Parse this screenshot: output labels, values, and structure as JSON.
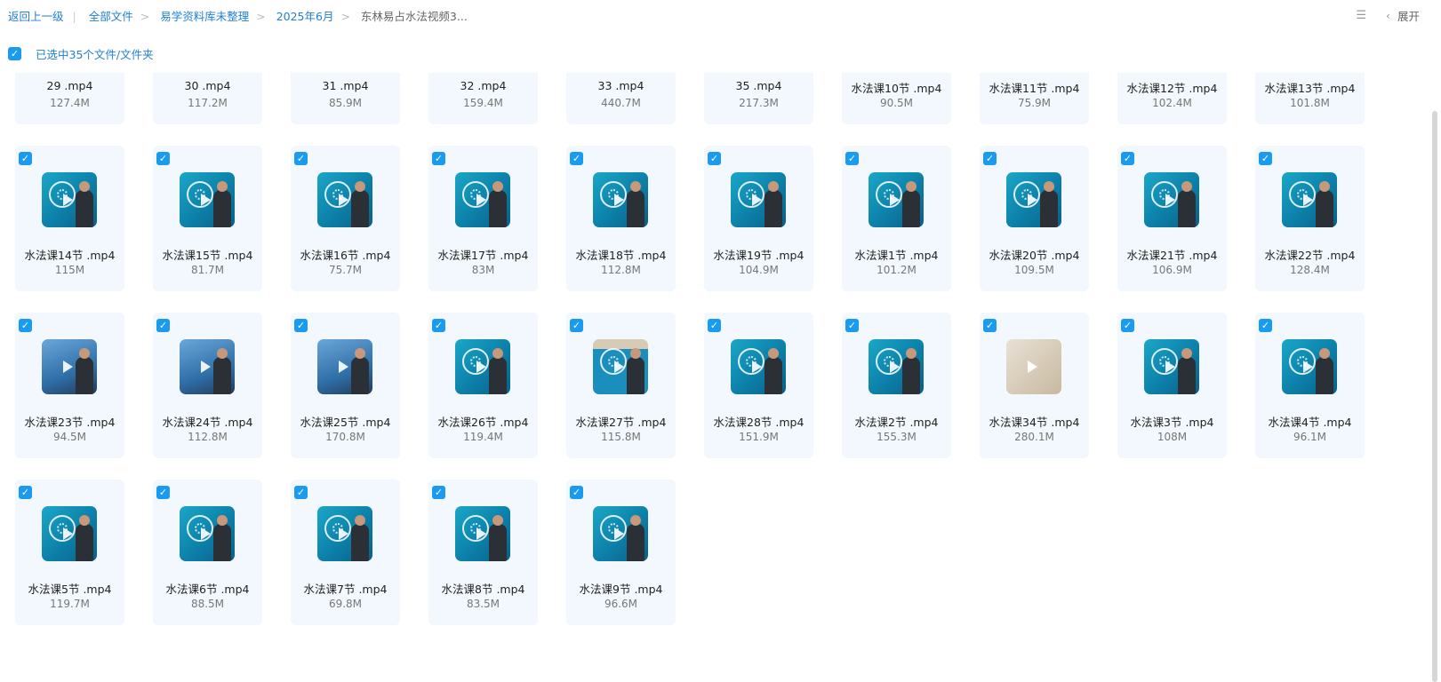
{
  "breadcrumb": {
    "back": "返回上一级",
    "items": [
      "全部文件",
      "易学资料库未整理",
      "2025年6月"
    ],
    "current": "东林易占水法视频3..."
  },
  "top_right": {
    "view_icon": "list-view-icon",
    "expand_label": "展开"
  },
  "selection": {
    "label": "已选中35个文件/文件夹",
    "checked": true
  },
  "colors": {
    "accent": "#1a9bf0",
    "link": "#1f7fd6",
    "card_bg": "#f2f8fd"
  },
  "files": [
    {
      "name": "29 .mp4",
      "size": "127.4M",
      "thumb": "mosaic"
    },
    {
      "name": "30 .mp4",
      "size": "117.2M",
      "thumb": "chart"
    },
    {
      "name": "31 .mp4",
      "size": "85.9M",
      "thumb": "chart"
    },
    {
      "name": "32 .mp4",
      "size": "159.4M",
      "thumb": "chart"
    },
    {
      "name": "33 .mp4",
      "size": "440.7M",
      "thumb": "mosaic"
    },
    {
      "name": "35 .mp4",
      "size": "217.3M",
      "thumb": "paper"
    },
    {
      "name": "水法课10节 .mp4",
      "size": "90.5M",
      "thumb": "lecture"
    },
    {
      "name": "水法课11节 .mp4",
      "size": "75.9M",
      "thumb": "lecture"
    },
    {
      "name": "水法课12节 .mp4",
      "size": "102.4M",
      "thumb": "lecture"
    },
    {
      "name": "水法课13节 .mp4",
      "size": "101.8M",
      "thumb": "lecture"
    },
    {
      "name": "水法课14节 .mp4",
      "size": "115M",
      "thumb": "lecture"
    },
    {
      "name": "水法课15节 .mp4",
      "size": "81.7M",
      "thumb": "lecture"
    },
    {
      "name": "水法课16节 .mp4",
      "size": "75.7M",
      "thumb": "lecture"
    },
    {
      "name": "水法课17节 .mp4",
      "size": "83M",
      "thumb": "lecture"
    },
    {
      "name": "水法课18节 .mp4",
      "size": "112.8M",
      "thumb": "lecture"
    },
    {
      "name": "水法课19节 .mp4",
      "size": "104.9M",
      "thumb": "lecture"
    },
    {
      "name": "水法课1节 .mp4",
      "size": "101.2M",
      "thumb": "lecture"
    },
    {
      "name": "水法课20节 .mp4",
      "size": "109.5M",
      "thumb": "lecture"
    },
    {
      "name": "水法课21节 .mp4",
      "size": "106.9M",
      "thumb": "lecture"
    },
    {
      "name": "水法课22节 .mp4",
      "size": "128.4M",
      "thumb": "lecture"
    },
    {
      "name": "水法课23节 .mp4",
      "size": "94.5M",
      "thumb": "lightwall"
    },
    {
      "name": "水法课24节 .mp4",
      "size": "112.8M",
      "thumb": "lightwall"
    },
    {
      "name": "水法课25节 .mp4",
      "size": "170.8M",
      "thumb": "lightwall"
    },
    {
      "name": "水法课26节 .mp4",
      "size": "119.4M",
      "thumb": "lecture"
    },
    {
      "name": "水法课27节 .mp4",
      "size": "115.8M",
      "thumb": "roomtop"
    },
    {
      "name": "水法课28节 .mp4",
      "size": "151.9M",
      "thumb": "lecture"
    },
    {
      "name": "水法课2节 .mp4",
      "size": "155.3M",
      "thumb": "lecture"
    },
    {
      "name": "水法课34节 .mp4",
      "size": "280.1M",
      "thumb": "paper"
    },
    {
      "name": "水法课3节 .mp4",
      "size": "108M",
      "thumb": "lecture"
    },
    {
      "name": "水法课4节 .mp4",
      "size": "96.1M",
      "thumb": "lecture"
    },
    {
      "name": "水法课5节 .mp4",
      "size": "119.7M",
      "thumb": "lecture"
    },
    {
      "name": "水法课6节 .mp4",
      "size": "88.5M",
      "thumb": "lecture"
    },
    {
      "name": "水法课7节 .mp4",
      "size": "69.8M",
      "thumb": "lecture"
    },
    {
      "name": "水法课8节 .mp4",
      "size": "83.5M",
      "thumb": "lecture"
    },
    {
      "name": "水法课9节 .mp4",
      "size": "96.6M",
      "thumb": "lecture"
    }
  ]
}
